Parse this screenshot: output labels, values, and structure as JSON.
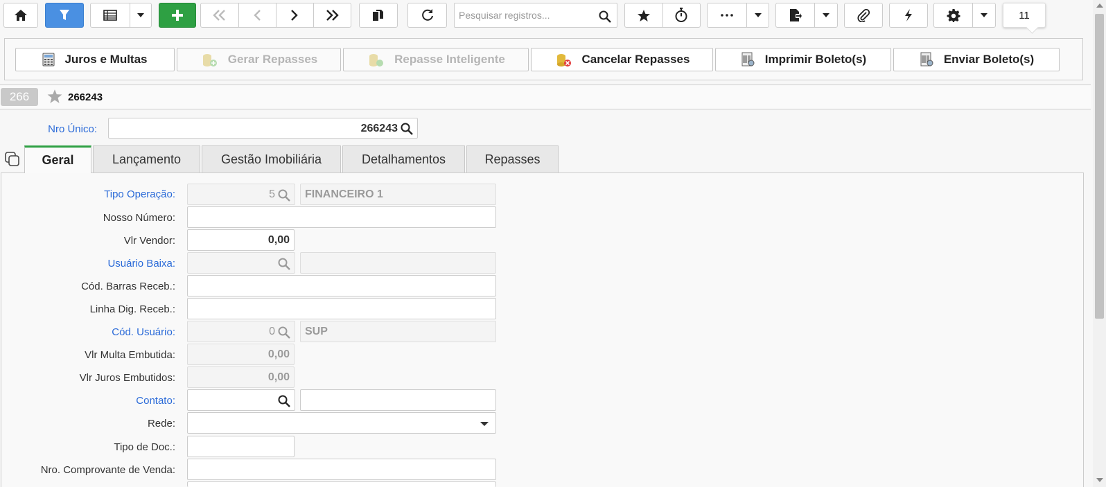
{
  "toolbar": {
    "search_placeholder": "Pesquisar registros...",
    "notification_count": "11"
  },
  "actions": [
    {
      "label": "Juros e Multas",
      "enabled": true,
      "icon": "calculator-icon"
    },
    {
      "label": "Gerar Repasses",
      "enabled": false,
      "icon": "coins-add-icon"
    },
    {
      "label": "Repasse Inteligente",
      "enabled": false,
      "icon": "coins-smart-icon"
    },
    {
      "label": "Cancelar Repasses",
      "enabled": true,
      "icon": "coins-cancel-icon"
    },
    {
      "label": "Imprimir Boleto(s)",
      "enabled": true,
      "icon": "print-invoice-icon"
    },
    {
      "label": "Enviar Boleto(s)",
      "enabled": true,
      "icon": "send-invoice-icon"
    }
  ],
  "record": {
    "number": "266",
    "title": "266243",
    "nro_unico_label": "Nro Único:",
    "nro_unico_value": "266243"
  },
  "tabs": [
    "Geral",
    "Lançamento",
    "Gestão Imobiliária",
    "Detalhamentos",
    "Repasses"
  ],
  "form": {
    "tipo_operacao": {
      "label": "Tipo Operação:",
      "code": "5",
      "desc": "FINANCEIRO 1"
    },
    "nosso_numero": {
      "label": "Nosso Número:",
      "value": ""
    },
    "vlr_vendor": {
      "label": "Vlr Vendor:",
      "value": "0,00"
    },
    "usuario_baixa": {
      "label": "Usuário Baixa:",
      "code": "",
      "desc": ""
    },
    "cod_barras": {
      "label": "Cód. Barras Receb.:",
      "value": ""
    },
    "linha_dig": {
      "label": "Linha Dig. Receb.:",
      "value": ""
    },
    "cod_usuario": {
      "label": "Cód. Usuário:",
      "code": "0",
      "desc": "SUP"
    },
    "vlr_multa": {
      "label": "Vlr Multa Embutida:",
      "value": "0,00"
    },
    "vlr_juros": {
      "label": "Vlr Juros Embutidos:",
      "value": "0,00"
    },
    "contato": {
      "label": "Contato:",
      "code": "",
      "desc": ""
    },
    "rede": {
      "label": "Rede:",
      "value": ""
    },
    "tipo_doc": {
      "label": "Tipo de Doc.:",
      "value": ""
    },
    "nro_comprovante": {
      "label": "Nro. Comprovante de Venda:",
      "value": ""
    }
  },
  "colors": {
    "accent_blue": "#4a90e2",
    "add_green": "#2ea043",
    "link_blue": "#2a6ad8",
    "active_tab_border": "#2ea043"
  }
}
